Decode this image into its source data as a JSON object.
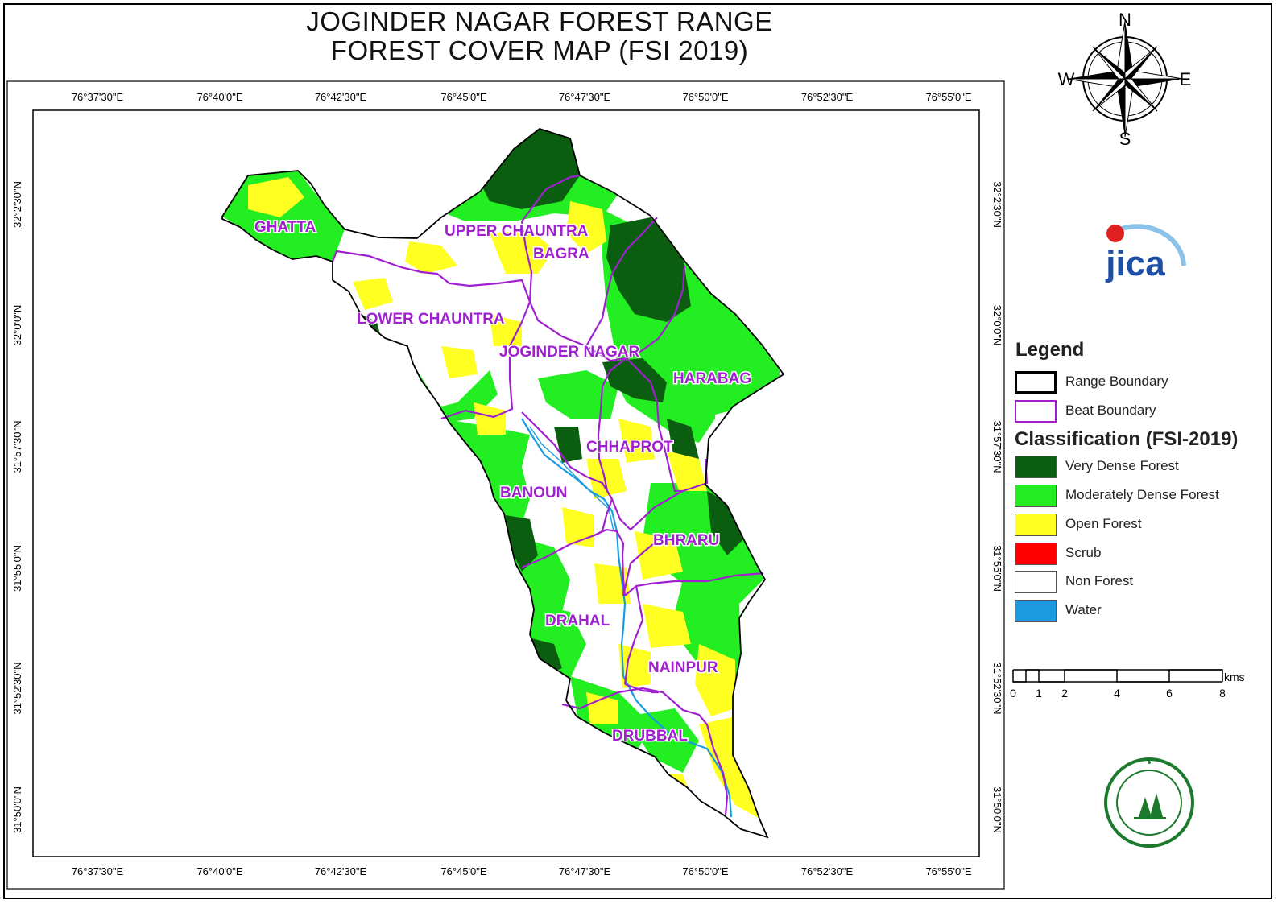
{
  "title": {
    "line1": "JOGINDER NAGAR FOREST RANGE",
    "line2": "FOREST COVER MAP (FSI 2019)"
  },
  "graticule": {
    "longitudes": [
      "76°37'30\"E",
      "76°40'0\"E",
      "76°42'30\"E",
      "76°45'0\"E",
      "76°47'30\"E",
      "76°50'0\"E",
      "76°52'30\"E",
      "76°55'0\"E"
    ],
    "latitudes": [
      "32°2'30\"N",
      "32°0'0\"N",
      "31°57'30\"N",
      "31°55'0\"N",
      "31°52'30\"N",
      "31°50'0\"N"
    ]
  },
  "beats": [
    "GHATTA",
    "UPPER CHAUNTRA",
    "BAGRA",
    "LOWER CHAUNTRA",
    "JOGINDER NAGAR",
    "HARABAG",
    "CHHAPROT",
    "BANOUN",
    "BHRARU",
    "DRAHAL",
    "NAINPUR",
    "DRUBBAL"
  ],
  "compass": {
    "n": "N",
    "s": "S",
    "e": "E",
    "w": "W"
  },
  "logo": {
    "name": "JICA",
    "text": "jica"
  },
  "legend": {
    "title": "Legend",
    "range_boundary": "Range Boundary",
    "beat_boundary": "Beat Boundary",
    "classification_title": "Classification (FSI-2019)",
    "classes": [
      {
        "label": "Very Dense Forest",
        "color": "#0b5e10"
      },
      {
        "label": "Moderately Dense Forest",
        "color": "#22ee22"
      },
      {
        "label": "Open Forest",
        "color": "#ffff22"
      },
      {
        "label": "Scrub",
        "color": "#ff0000"
      },
      {
        "label": "Non Forest",
        "color": "#ffffff"
      },
      {
        "label": "Water",
        "color": "#1a9be0"
      }
    ]
  },
  "scale": {
    "ticks": [
      "0",
      "1",
      "2",
      "4",
      "6",
      "8"
    ],
    "unit": "kms"
  },
  "colors": {
    "beat_boundary": "#a020d0",
    "range_boundary": "#000000",
    "river": "#1a9be0"
  }
}
